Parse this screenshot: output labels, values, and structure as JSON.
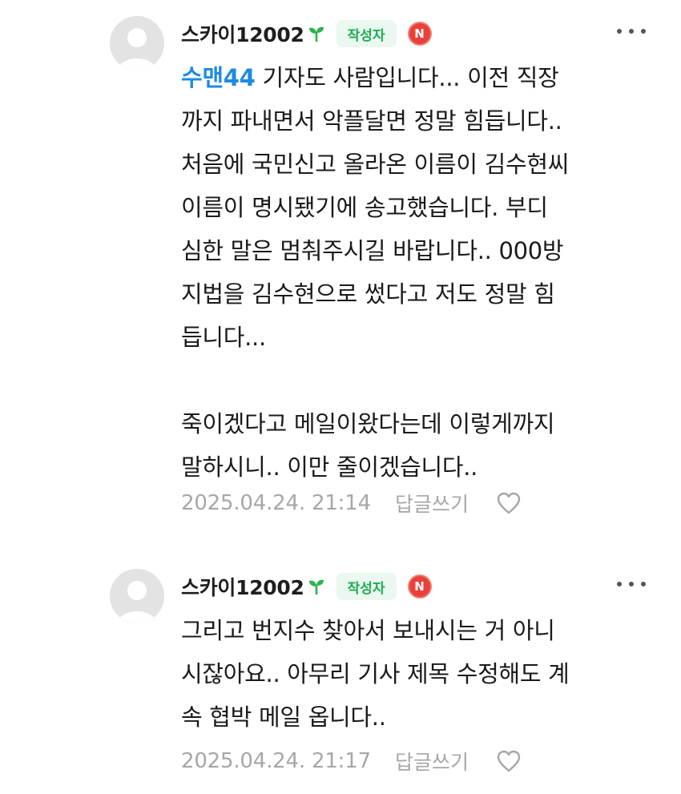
{
  "comments": [
    {
      "author": "스카이12002",
      "author_badge": "작성자",
      "n_badge": "N",
      "mention": "수맨44",
      "lines": [
        " 기자도 사람입니다... 이전 직장",
        "까지 파내면서 악플달면 정말 힘듭니다..",
        "처음에 국민신고 올라온 이름이 김수현씨",
        "이름이 명시됐기에 송고했습니다. 부디",
        "심한 말은 멈춰주시길 바랍니다.. 000방",
        "지법을 김수현으로 썼다고 저도 정말 힘",
        "듭니다...",
        "",
        "죽이겠다고 메일이왔다는데 이렇게까지",
        "말하시니.. 이만 줄이겠습니다.."
      ],
      "timestamp": "2025.04.24. 21:14",
      "reply_label": "답글쓰기"
    },
    {
      "author": "스카이12002",
      "author_badge": "작성자",
      "n_badge": "N",
      "lines": [
        "그리고 번지수 찾아서 보내시는 거 아니",
        "시잖아요.. 아무리 기사 제목 수정해도 계",
        "속 협박 메일 옵니다.."
      ],
      "timestamp": "2025.04.24. 21:17",
      "reply_label": "답글쓰기"
    }
  ],
  "colors": {
    "badge_green": "#1fab55",
    "badge_bg": "#eaf8ef",
    "mention_blue": "#1e8be0",
    "n_badge_red": "#e8413a",
    "meta_gray": "#a7a7a7"
  },
  "icons": [
    "avatar-placeholder",
    "sprout-icon",
    "more-options-icon",
    "heart-icon"
  ]
}
